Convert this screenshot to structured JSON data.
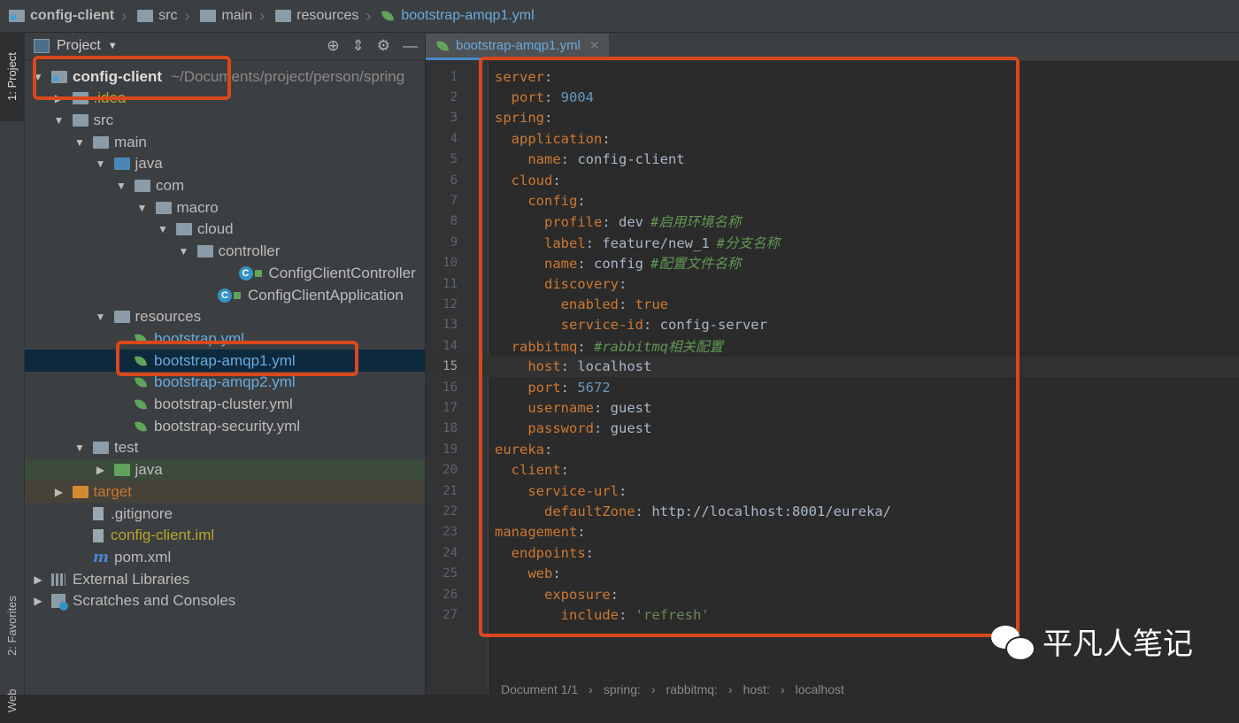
{
  "breadcrumb": {
    "items": [
      "config-client",
      "src",
      "main",
      "resources",
      "bootstrap-amqp1.yml"
    ]
  },
  "left_strip": {
    "project_tab": "1: Project",
    "favorites_tab": "2: Favorites",
    "web_tab": "Web"
  },
  "project_panel": {
    "title": "Project",
    "tools": {
      "locate": "⊕",
      "collapse": "⇕",
      "settings": "⚙",
      "hide": "—"
    },
    "tree": [
      {
        "label": "config-client",
        "extra": "~/Documents/project/person/spring",
        "indent": 0,
        "arrow": "▼",
        "icon": "module",
        "style": "bold"
      },
      {
        "label": ".idea",
        "indent": 1,
        "arrow": "▶",
        "icon": "folder",
        "style": "olive"
      },
      {
        "label": "src",
        "indent": 1,
        "arrow": "▼",
        "icon": "folder",
        "style": "normal"
      },
      {
        "label": "main",
        "indent": 2,
        "arrow": "▼",
        "icon": "folder",
        "style": "normal"
      },
      {
        "label": "java",
        "indent": 3,
        "arrow": "▼",
        "icon": "folder-blue",
        "style": "normal"
      },
      {
        "label": "com",
        "indent": 4,
        "arrow": "▼",
        "icon": "package",
        "style": "normal"
      },
      {
        "label": "macro",
        "indent": 5,
        "arrow": "▼",
        "icon": "package",
        "style": "normal"
      },
      {
        "label": "cloud",
        "indent": 6,
        "arrow": "▼",
        "icon": "package",
        "style": "normal"
      },
      {
        "label": "controller",
        "indent": 7,
        "arrow": "▼",
        "icon": "package",
        "style": "normal"
      },
      {
        "label": "ConfigClientController",
        "indent": 9,
        "arrow": "",
        "icon": "class",
        "style": "normal"
      },
      {
        "label": "ConfigClientApplication",
        "indent": 8,
        "arrow": "",
        "icon": "class",
        "style": "normal"
      },
      {
        "label": "resources",
        "indent": 3,
        "arrow": "▼",
        "icon": "folder-res",
        "style": "normal"
      },
      {
        "label": "bootstrap.yml",
        "indent": 4,
        "arrow": "",
        "icon": "spring",
        "style": "blue"
      },
      {
        "label": "bootstrap-amqp1.yml",
        "indent": 4,
        "arrow": "",
        "icon": "spring",
        "style": "blue",
        "selected": true
      },
      {
        "label": "bootstrap-amqp2.yml",
        "indent": 4,
        "arrow": "",
        "icon": "spring",
        "style": "blue"
      },
      {
        "label": "bootstrap-cluster.yml",
        "indent": 4,
        "arrow": "",
        "icon": "spring",
        "style": "normal"
      },
      {
        "label": "bootstrap-security.yml",
        "indent": 4,
        "arrow": "",
        "icon": "spring",
        "style": "normal"
      },
      {
        "label": "test",
        "indent": 2,
        "arrow": "▼",
        "icon": "folder",
        "style": "normal"
      },
      {
        "label": "java",
        "indent": 3,
        "arrow": "▶",
        "icon": "folder-green",
        "style": "normal",
        "bg": "test"
      },
      {
        "label": "target",
        "indent": 1,
        "arrow": "▶",
        "icon": "folder-orange",
        "style": "orange",
        "bg": "target"
      },
      {
        "label": ".gitignore",
        "indent": 2,
        "arrow": "",
        "icon": "file",
        "style": "normal"
      },
      {
        "label": "config-client.iml",
        "indent": 2,
        "arrow": "",
        "icon": "file",
        "style": "olive"
      },
      {
        "label": "pom.xml",
        "indent": 2,
        "arrow": "",
        "icon": "maven",
        "style": "normal"
      },
      {
        "label": "External Libraries",
        "indent": 0,
        "arrow": "▶",
        "icon": "library",
        "style": "normal"
      },
      {
        "label": "Scratches and Consoles",
        "indent": 0,
        "arrow": "▶",
        "icon": "scratch",
        "style": "normal"
      }
    ]
  },
  "editor": {
    "tab_label": "bootstrap-amqp1.yml",
    "tab_close": "✕",
    "current_line": 15,
    "lines": [
      {
        "n": "1",
        "indent": "",
        "key": "server",
        "sep": ":",
        "value": "",
        "vtype": "",
        "comment": ""
      },
      {
        "n": "2",
        "indent": "  ",
        "key": "port",
        "sep": ": ",
        "value": "9004",
        "vtype": "num",
        "comment": ""
      },
      {
        "n": "3",
        "indent": "",
        "key": "spring",
        "sep": ":",
        "value": "",
        "vtype": "",
        "comment": ""
      },
      {
        "n": "4",
        "indent": "  ",
        "key": "application",
        "sep": ":",
        "value": "",
        "vtype": "",
        "comment": ""
      },
      {
        "n": "5",
        "indent": "    ",
        "key": "name",
        "sep": ": ",
        "value": "config-client",
        "vtype": "plain",
        "comment": ""
      },
      {
        "n": "6",
        "indent": "  ",
        "key": "cloud",
        "sep": ":",
        "value": "",
        "vtype": "",
        "comment": ""
      },
      {
        "n": "7",
        "indent": "    ",
        "key": "config",
        "sep": ":",
        "value": "",
        "vtype": "",
        "comment": ""
      },
      {
        "n": "8",
        "indent": "      ",
        "key": "profile",
        "sep": ": ",
        "value": "dev",
        "vtype": "plain",
        "comment": "#启用环境名称"
      },
      {
        "n": "9",
        "indent": "      ",
        "key": "label",
        "sep": ": ",
        "value": "feature/new_1",
        "vtype": "plain",
        "comment": "#分支名称"
      },
      {
        "n": "10",
        "indent": "      ",
        "key": "name",
        "sep": ": ",
        "value": "config",
        "vtype": "plain",
        "comment": "#配置文件名称"
      },
      {
        "n": "11",
        "indent": "      ",
        "key": "discovery",
        "sep": ":",
        "value": "",
        "vtype": "",
        "comment": ""
      },
      {
        "n": "12",
        "indent": "        ",
        "key": "enabled",
        "sep": ": ",
        "value": "true",
        "vtype": "bool",
        "comment": ""
      },
      {
        "n": "13",
        "indent": "        ",
        "key": "service-id",
        "sep": ": ",
        "value": "config-server",
        "vtype": "plain",
        "comment": ""
      },
      {
        "n": "14",
        "indent": "  ",
        "key": "rabbitmq",
        "sep": ": ",
        "value": "",
        "vtype": "",
        "comment": "#rabbitmq相关配置"
      },
      {
        "n": "15",
        "indent": "    ",
        "key": "host",
        "sep": ": ",
        "value": "localhost",
        "vtype": "plain",
        "comment": ""
      },
      {
        "n": "16",
        "indent": "    ",
        "key": "port",
        "sep": ": ",
        "value": "5672",
        "vtype": "num",
        "comment": ""
      },
      {
        "n": "17",
        "indent": "    ",
        "key": "username",
        "sep": ": ",
        "value": "guest",
        "vtype": "plain",
        "comment": ""
      },
      {
        "n": "18",
        "indent": "    ",
        "key": "password",
        "sep": ": ",
        "value": "guest",
        "vtype": "plain",
        "comment": ""
      },
      {
        "n": "19",
        "indent": "",
        "key": "eureka",
        "sep": ":",
        "value": "",
        "vtype": "",
        "comment": ""
      },
      {
        "n": "20",
        "indent": "  ",
        "key": "client",
        "sep": ":",
        "value": "",
        "vtype": "",
        "comment": ""
      },
      {
        "n": "21",
        "indent": "    ",
        "key": "service-url",
        "sep": ":",
        "value": "",
        "vtype": "",
        "comment": ""
      },
      {
        "n": "22",
        "indent": "      ",
        "key": "defaultZone",
        "sep": ": ",
        "value": "http://localhost:8001/eureka/",
        "vtype": "plain",
        "comment": ""
      },
      {
        "n": "23",
        "indent": "",
        "key": "management",
        "sep": ":",
        "value": "",
        "vtype": "",
        "comment": ""
      },
      {
        "n": "24",
        "indent": "  ",
        "key": "endpoints",
        "sep": ":",
        "value": "",
        "vtype": "",
        "comment": ""
      },
      {
        "n": "25",
        "indent": "    ",
        "key": "web",
        "sep": ":",
        "value": "",
        "vtype": "",
        "comment": ""
      },
      {
        "n": "26",
        "indent": "      ",
        "key": "exposure",
        "sep": ":",
        "value": "",
        "vtype": "",
        "comment": ""
      },
      {
        "n": "27",
        "indent": "        ",
        "key": "include",
        "sep": ": ",
        "value": "'refresh'",
        "vtype": "str",
        "comment": ""
      }
    ]
  },
  "status_breadcrumb": [
    "Document 1/1",
    "›",
    "spring:",
    "›",
    "rabbitmq:",
    "›",
    "host:",
    "›",
    "localhost"
  ],
  "watermark": {
    "text": "平凡人笔记"
  },
  "colors": {
    "highlight_box": "#d9481c",
    "selection": "#0d293e",
    "accent": "#6aa9dc"
  }
}
